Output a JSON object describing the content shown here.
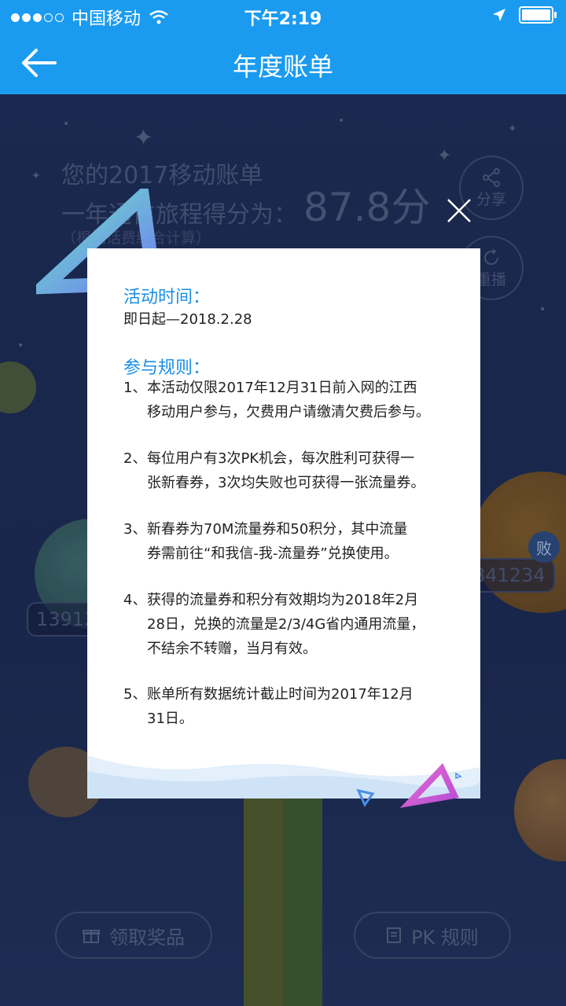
{
  "status_bar": {
    "carrier": "中国移动",
    "time": "下午2:19"
  },
  "nav": {
    "title": "年度账单"
  },
  "background": {
    "headline_line1": "您的2017移动账单",
    "headline_line2": "一年通信旅程得分为：",
    "score": "87.8分",
    "note": "（根据话费综合计算）",
    "share_label": "分享",
    "replay_label": "重播",
    "number_left": "13912",
    "number_right": "841234",
    "lose_badge": "败",
    "prize_button": "领取奖品",
    "pk_rules_button": "PK 规则"
  },
  "modal": {
    "activity_time_title": "活动时间：",
    "activity_time_value": "即日起—2018.2.28",
    "rules_title": "参与规则：",
    "rules": [
      {
        "num": "1、",
        "lines": [
          "本活动仅限2017年12月31日前入网的江西",
          "移动用户参与，欠费用户请缴清欠费后参与。"
        ]
      },
      {
        "num": "2、",
        "lines": [
          "每位用户有3次PK机会，每次胜利可获得一",
          "张新春券，3次均失败也可获得一张流量券。"
        ]
      },
      {
        "num": "3、",
        "lines": [
          "新春券为70M流量券和50积分，其中流量",
          "券需前往“和我信-我-流量券”兑换使用。"
        ]
      },
      {
        "num": "4、",
        "lines": [
          "获得的流量券和积分有效期均为2018年2月",
          "28日，兑换的流量是2/3/4G省内通用流量，",
          "不结余不转赠，当月有效。"
        ]
      },
      {
        "num": "5、",
        "lines": [
          "账单所有数据统计截止时间为2017年12月",
          "31日。"
        ]
      }
    ]
  },
  "colors": {
    "nav_blue": "#1a9bf0",
    "title_blue": "#1a8fe6",
    "scene_bg": "#1e2c55"
  }
}
